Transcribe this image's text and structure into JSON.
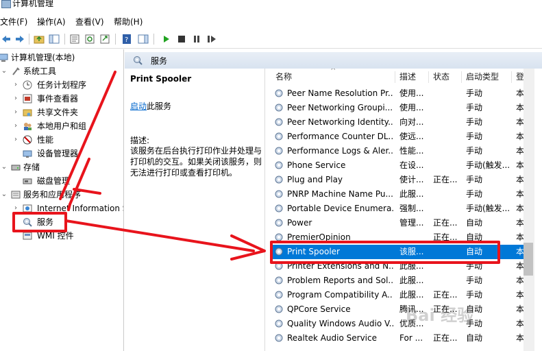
{
  "window": {
    "title": "计算机管理"
  },
  "menu": [
    "文件(F)",
    "操作(A)",
    "查看(V)",
    "帮助(H)"
  ],
  "tree": {
    "root": "计算机管理(本地)",
    "system_tools": "系统工具",
    "task_scheduler": "任务计划程序",
    "event_viewer": "事件查看器",
    "shared_folders": "共享文件夹",
    "local_users": "本地用户和组",
    "performance": "性能",
    "device_manager": "设备管理器",
    "storage": "存储",
    "disk_management": "磁盘管理",
    "services_apps": "服务和应用程序",
    "iis": "Internet Information S",
    "services": "服务",
    "wmi": "WMI 控件"
  },
  "header": {
    "title": "服务"
  },
  "detail": {
    "service_name": "Print Spooler",
    "start_link": "启动",
    "start_suffix": "此服务",
    "desc_label": "描述:",
    "desc_text": "该服务在后台执行打印作业并处理与打印机的交互。如果关闭该服务，则无法进行打印或查看打印机。"
  },
  "columns": {
    "name": "名称",
    "desc": "描述",
    "status": "状态",
    "start_type": "启动类型",
    "logon": "登"
  },
  "rows": [
    {
      "name": "Peer Name Resolution Pr...",
      "desc": "使用...",
      "status": "",
      "start": "手动",
      "logon": "本"
    },
    {
      "name": "Peer Networking Groupi...",
      "desc": "使用...",
      "status": "",
      "start": "手动",
      "logon": "本"
    },
    {
      "name": "Peer Networking Identity...",
      "desc": "向对...",
      "status": "",
      "start": "手动",
      "logon": "本"
    },
    {
      "name": "Performance Counter DL...",
      "desc": "使远...",
      "status": "",
      "start": "手动",
      "logon": "本"
    },
    {
      "name": "Performance Logs & Aler...",
      "desc": "性能...",
      "status": "",
      "start": "手动",
      "logon": "本"
    },
    {
      "name": "Phone Service",
      "desc": "在设...",
      "status": "",
      "start": "手动(触发...",
      "logon": "本"
    },
    {
      "name": "Plug and Play",
      "desc": "使计...",
      "status": "正在...",
      "start": "手动",
      "logon": "本"
    },
    {
      "name": "PNRP Machine Name Pu...",
      "desc": "此服...",
      "status": "",
      "start": "手动",
      "logon": "本"
    },
    {
      "name": "Portable Device Enumera...",
      "desc": "强制...",
      "status": "",
      "start": "手动(触发...",
      "logon": "本"
    },
    {
      "name": "Power",
      "desc": "管理...",
      "status": "正在...",
      "start": "自动",
      "logon": "本"
    },
    {
      "name": "PremierOpinion",
      "desc": "",
      "status": "正在...",
      "start": "自动",
      "logon": "本"
    },
    {
      "name": "Print Spooler",
      "desc": "该服...",
      "status": "",
      "start": "自动",
      "logon": "本"
    },
    {
      "name": "Printer Extensions and N...",
      "desc": "此服...",
      "status": "",
      "start": "手动",
      "logon": "本"
    },
    {
      "name": "Problem Reports and Sol...",
      "desc": "此服...",
      "status": "",
      "start": "手动",
      "logon": "本"
    },
    {
      "name": "Program Compatibility A...",
      "desc": "此服...",
      "status": "正在...",
      "start": "手动",
      "logon": "本"
    },
    {
      "name": "QPCore Service",
      "desc": "腾讯...",
      "status": "正在...",
      "start": "自动",
      "logon": "本"
    },
    {
      "name": "Quality Windows Audio V...",
      "desc": "优质...",
      "status": "",
      "start": "手动",
      "logon": "本"
    },
    {
      "name": "Realtek Audio Service",
      "desc": "For ...",
      "status": "正在...",
      "start": "自动",
      "logon": "本"
    }
  ],
  "selected_row_index": 11,
  "watermark": "Bai 经验",
  "colors": {
    "selection": "#0078d7",
    "annotation": "#e8141c",
    "link": "#0066cc"
  }
}
